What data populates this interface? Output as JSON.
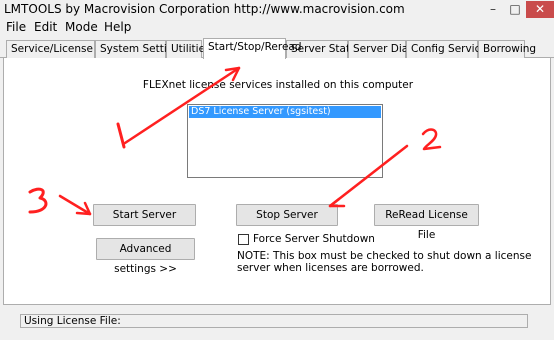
{
  "window": {
    "title": "LMTOOLS by Macrovision Corporation http://www.macrovision.com",
    "minimize_glyph": "–",
    "maximize_glyph": "□",
    "close_glyph": "✕"
  },
  "menu": [
    "File",
    "Edit",
    "Mode",
    "Help"
  ],
  "tabs": [
    {
      "label": "Service/License File",
      "active": false
    },
    {
      "label": "System Settings",
      "active": false
    },
    {
      "label": "Utilities",
      "active": false
    },
    {
      "label": "Start/Stop/Reread",
      "active": true
    },
    {
      "label": "Server Status",
      "active": false
    },
    {
      "label": "Server Diags",
      "active": false
    },
    {
      "label": "Config Services",
      "active": false
    },
    {
      "label": "Borrowing",
      "active": false
    }
  ],
  "panel": {
    "heading": "FLEXnet license services installed on this computer",
    "list_items": [
      "DS7 License Server (sgsitest)"
    ],
    "start_server": "Start Server",
    "stop_server": "Stop Server",
    "reread": "ReRead License File",
    "advanced": "Advanced settings >>",
    "force_label": "Force Server Shutdown",
    "note": "NOTE:  This box must be checked to shut down a license server when licenses are borrowed."
  },
  "status": {
    "label": "Using License File:"
  },
  "annotations": {
    "color": "#ff2020",
    "numbers": [
      "1",
      "2",
      "3"
    ]
  }
}
